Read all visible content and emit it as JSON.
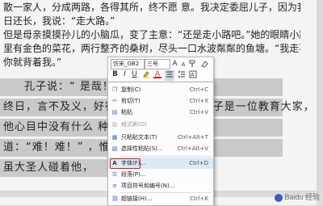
{
  "document": {
    "lines": [
      "散一家人，分成两路，各得其所，终不愿  意。我决定委屈儿子，因为我伴同他的时",
      "日还长，我说：“走大路。”",
      "但是母亲摸摸孙儿的小脑瓜，变了主意：“还是走小路吧。”她的眼睛小路望去：那",
      "里有金色的菜花，两行整齐的桑树，尽头一口水波粼粼的鱼塘。“我走不过去的地方，",
      "你就背着我。”"
    ],
    "selected_lines": [
      "孔子说：“                              是哉！”又说：“群居",
      "终日，言不及义，好行小慧，难矣哉！”孔子是一位教育大家，",
      "他心目中没有什么                              种人便摇头叹气说",
      "道：“难！难！”                              ，惟有无业游民，",
      "虽大圣人碰着他，"
    ]
  },
  "toolbar": {
    "font_name": "仿宋_GB2",
    "font_size": "三号",
    "grow_icon": "A",
    "shrink_icon": "A",
    "bold": "B",
    "italic": "I",
    "underline": "U",
    "font_color": "A"
  },
  "menu": {
    "items": [
      {
        "icon": "copy-icon",
        "label": "复制(C)",
        "shortcut": "Ctrl+C",
        "disabled": false
      },
      {
        "icon": "cut-icon",
        "label": "剪切(T)",
        "shortcut": "Ctrl+X",
        "disabled": false
      },
      {
        "icon": "paste-icon",
        "label": "粘贴",
        "shortcut": "Ctrl+V",
        "disabled": false
      },
      {
        "icon": "paste-format-icon",
        "label": "格式刷(O)",
        "shortcut": "",
        "disabled": true
      },
      {
        "icon": "paste-text-icon",
        "label": "只粘贴文本(T)",
        "shortcut": "Ctrl+Alt+T",
        "disabled": false
      },
      {
        "icon": "paste-special-icon",
        "label": "选择性粘贴(S)...",
        "shortcut": "Ctrl+Alt+V",
        "disabled": false
      },
      {
        "icon": "font-icon",
        "label": "字体(F)...",
        "shortcut": "Ctrl+D",
        "disabled": false
      },
      {
        "icon": "paragraph-icon",
        "label": "段落(P)...",
        "shortcut": "",
        "disabled": false
      },
      {
        "icon": "bullets-icon",
        "label": "项目符号和编号(N)...",
        "shortcut": "",
        "disabled": false
      },
      {
        "icon": "link-icon",
        "label": "超链接(H)...",
        "shortcut": "Ctrl+K",
        "disabled": false
      }
    ]
  },
  "watermark": "Baidu 经验"
}
